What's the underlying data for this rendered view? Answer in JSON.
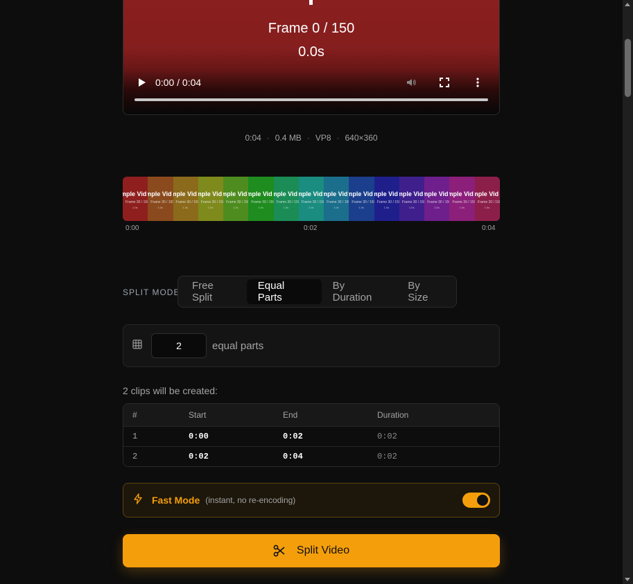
{
  "video": {
    "frame_text": "Frame 0 / 150",
    "time_text": "0.0s",
    "timecode": "0:00 / 0:04",
    "progress": 0
  },
  "meta": {
    "duration": "0:04",
    "size": "0.4 MB",
    "codec": "VP8",
    "resolution": "640×360"
  },
  "thumbnails": {
    "title": "mple Vid",
    "subtitle": "Frame 30 / 150",
    "time": "1.0s",
    "colors": [
      "#8f1f1f",
      "#8a4a1d",
      "#8c6a1b",
      "#7e8a1c",
      "#4e8c1f",
      "#1e8c1e",
      "#1b8c55",
      "#1a8c80",
      "#1b6e8c",
      "#1b3f8c",
      "#1f1f8c",
      "#3f1f8c",
      "#6e1f8c",
      "#8c1f7a",
      "#8c1f4a"
    ],
    "labels": [
      "0:00",
      "0:02",
      "0:04"
    ]
  },
  "split_mode": {
    "label": "SPLIT MODE",
    "tabs": [
      "Free Split",
      "Equal Parts",
      "By Duration",
      "By Size"
    ],
    "active": "Equal Parts"
  },
  "parts": {
    "value": "2",
    "label": "equal parts"
  },
  "clips": {
    "title": "2 clips will be created:",
    "headers": [
      "#",
      "Start",
      "End",
      "Duration"
    ],
    "rows": [
      [
        "1",
        "0:00",
        "0:02",
        "0:02"
      ],
      [
        "2",
        "0:02",
        "0:04",
        "0:02"
      ]
    ]
  },
  "fast_mode": {
    "label": "Fast Mode",
    "description": "(instant, no re-encoding)",
    "enabled": true
  },
  "split_button": {
    "label": "Split Video"
  },
  "colors": {
    "accent": "#f59e0b",
    "background": "#0d0d0d"
  }
}
